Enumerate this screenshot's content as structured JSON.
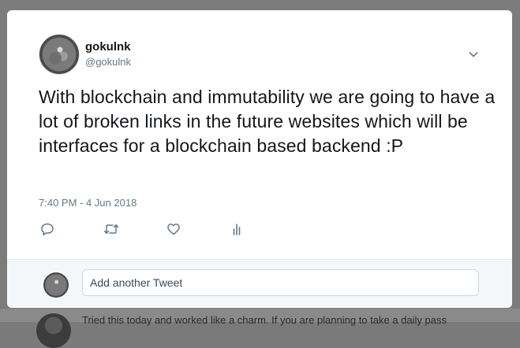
{
  "background": {
    "snippet_text": "Tried this today and worked like a charm. If you are planning to take a daily pass"
  },
  "tweet": {
    "display_name": "gokulnk",
    "handle": "@gokulnk",
    "text": "With blockchain and immutability we are going to have a lot of broken links in the future websites which will be interfaces for a blockchain based backend :P",
    "timestamp": "7:40 PM - 4 Jun 2018",
    "icons": {
      "caret": "chevron-down-icon",
      "reply": "reply-icon",
      "retweet": "retweet-icon",
      "like": "heart-icon",
      "analytics": "analytics-icon"
    }
  },
  "reply_box": {
    "placeholder": "Add another Tweet"
  },
  "colors": {
    "text_primary": "#14171a",
    "text_secondary": "#657786",
    "icon": "#657786",
    "reply_bg": "#f5f8fa"
  }
}
